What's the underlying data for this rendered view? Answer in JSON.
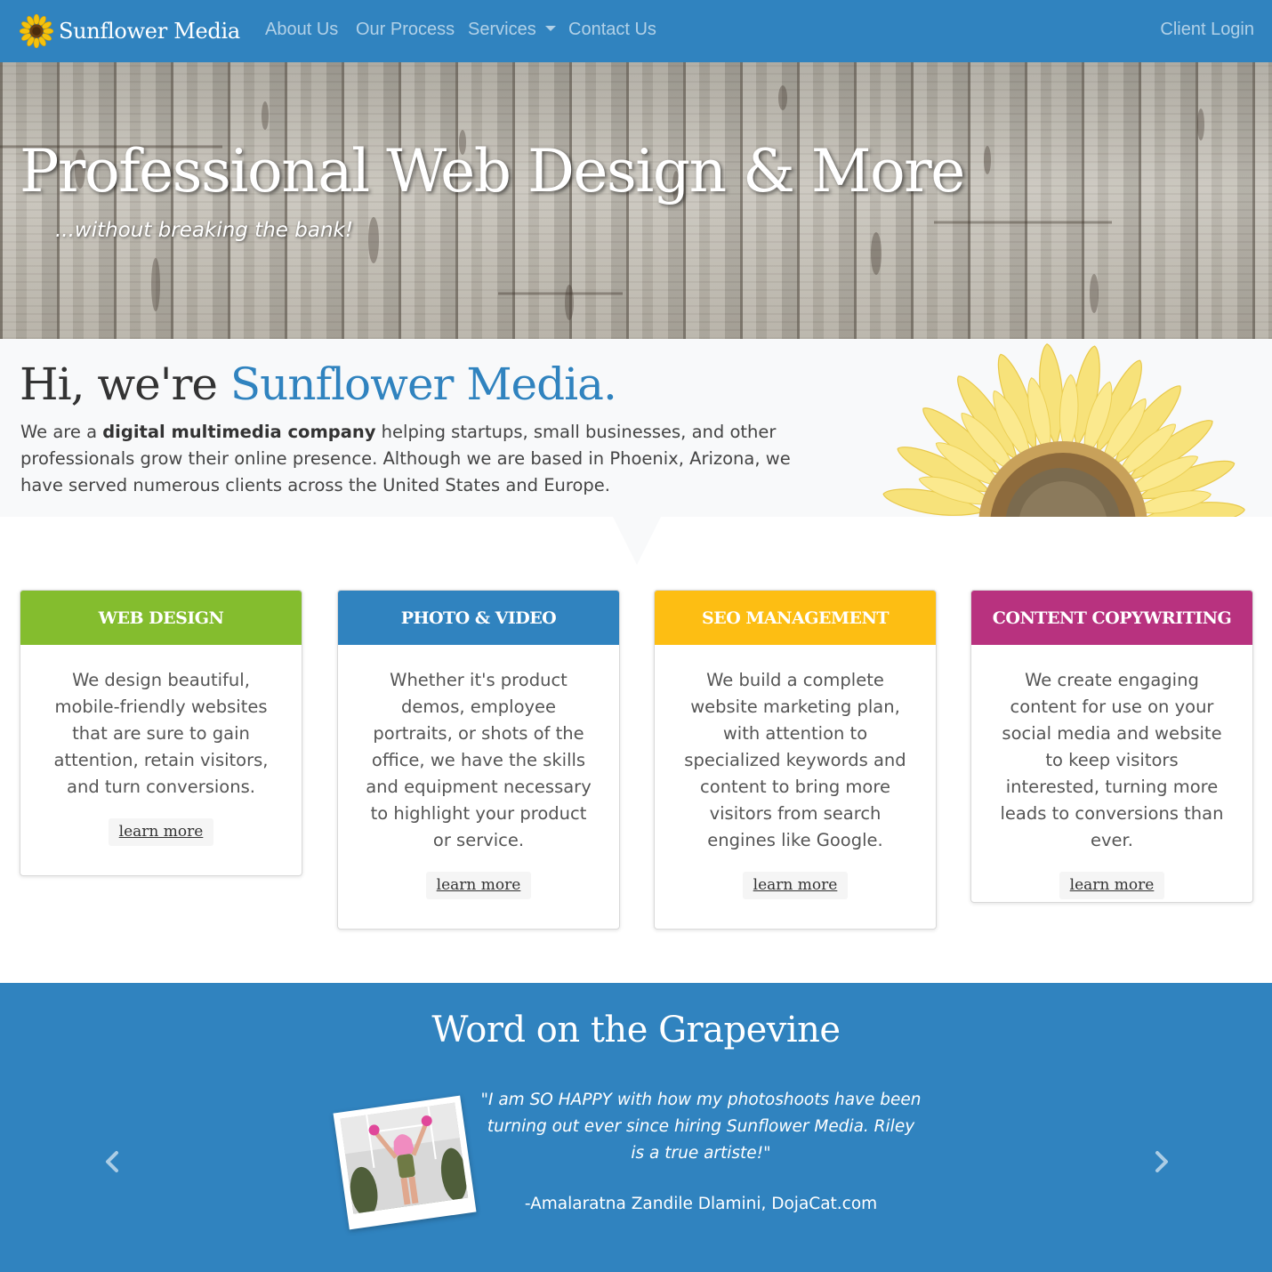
{
  "navbar": {
    "brand": "Sunflower Media",
    "links": {
      "about": "About Us",
      "process": "Our Process",
      "services": "Services",
      "contact": "Contact Us"
    },
    "login": "Client Login",
    "background_color": "#3083bf"
  },
  "hero": {
    "title": "Professional Web Design & More",
    "subtitle": "...without breaking the bank!"
  },
  "intro": {
    "heading_prefix": "Hi, we're ",
    "heading_accent": "Sunflower Media.",
    "text_before": "We are a ",
    "text_bold": "digital multimedia company",
    "text_after": " helping startups, small businesses, and other professionals grow their online presence. Although we are based in Phoenix, Arizona, we have served numerous clients across the United States and Europe."
  },
  "services": [
    {
      "title": "WEB DESIGN",
      "text": "We design beautiful, mobile-friendly websites that are sure to gain attention, retain visitors, and turn conversions.",
      "button": "learn more",
      "color": "#84bd2e"
    },
    {
      "title": "PHOTO & VIDEO",
      "text": "Whether it's product demos, employee portraits, or shots of the office, we have the skills and equipment necessary to highlight your product or service.",
      "button": "learn more",
      "color": "#3083bf"
    },
    {
      "title": "SEO MANAGEMENT",
      "text": "We build a complete website marketing plan, with attention to specialized keywords and content to bring more visitors from search engines like Google.",
      "button": "learn more",
      "color": "#fdbe13"
    },
    {
      "title": "CONTENT COPYWRITING",
      "text": "We create engaging content for use on your social media and website to keep visitors interested, turning more leads to conversions than ever.",
      "button": "learn more",
      "color": "#b8327f"
    }
  ],
  "testimonials": {
    "heading": "Word on the Grapevine",
    "quote": "\"I am SO HAPPY with how my photoshoots have been turning out ever since hiring Sunflower Media. Riley is a true artiste!\"",
    "author": "-Amalaratna Zandile Dlamini, DojaCat.com",
    "prev_icon": "chevron-left-icon",
    "next_icon": "chevron-right-icon"
  }
}
